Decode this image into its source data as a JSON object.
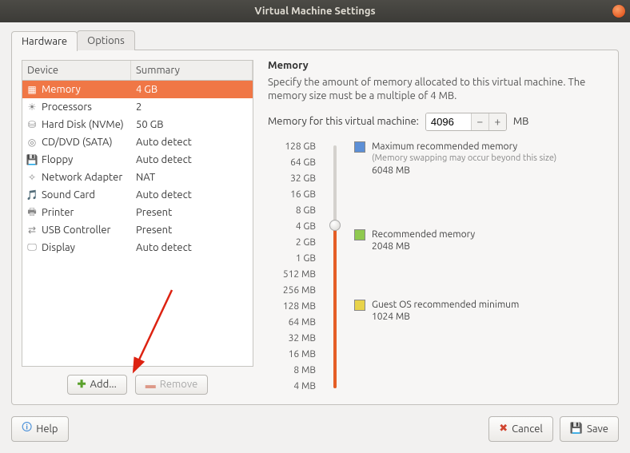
{
  "title": "Virtual Machine Settings",
  "tabs": {
    "hardware": "Hardware",
    "options": "Options"
  },
  "table": {
    "headers": {
      "device": "Device",
      "summary": "Summary"
    },
    "rows": [
      {
        "name": "Memory",
        "summary": "4 GB",
        "icon": "memory"
      },
      {
        "name": "Processors",
        "summary": "2",
        "icon": "cpu"
      },
      {
        "name": "Hard Disk (NVMe)",
        "summary": "50 GB",
        "icon": "hdd"
      },
      {
        "name": "CD/DVD (SATA)",
        "summary": "Auto detect",
        "icon": "cd"
      },
      {
        "name": "Floppy",
        "summary": "Auto detect",
        "icon": "floppy"
      },
      {
        "name": "Network Adapter",
        "summary": "NAT",
        "icon": "net"
      },
      {
        "name": "Sound Card",
        "summary": "Auto detect",
        "icon": "sound"
      },
      {
        "name": "Printer",
        "summary": "Present",
        "icon": "printer"
      },
      {
        "name": "USB Controller",
        "summary": "Present",
        "icon": "usb"
      },
      {
        "name": "Display",
        "summary": "Auto detect",
        "icon": "display"
      }
    ],
    "selected_index": 0
  },
  "buttons": {
    "add": "Add...",
    "remove": "Remove",
    "help": "Help",
    "cancel": "Cancel",
    "save": "Save"
  },
  "memory": {
    "heading": "Memory",
    "description": "Specify the amount of memory allocated to this virtual machine. The memory size must be a multiple of 4 MB.",
    "input_label": "Memory for this virtual machine:",
    "value": "4096",
    "unit": "MB",
    "ticks": [
      "128 GB",
      "64 GB",
      "32 GB",
      "16 GB",
      "8 GB",
      "4 GB",
      "2 GB",
      "1 GB",
      "512 MB",
      "256 MB",
      "128 MB",
      "64 MB",
      "32 MB",
      "16 MB",
      "8 MB",
      "4 MB"
    ],
    "markers": {
      "max": {
        "label": "Maximum recommended memory",
        "sub": "(Memory swapping may occur beyond this size)",
        "value": "6048 MB",
        "color": "#5c8fd6"
      },
      "rec": {
        "label": "Recommended memory",
        "value": "2048 MB",
        "color": "#8fc94f"
      },
      "min": {
        "label": "Guest OS recommended minimum",
        "value": "1024 MB",
        "color": "#e8d34a"
      }
    }
  }
}
